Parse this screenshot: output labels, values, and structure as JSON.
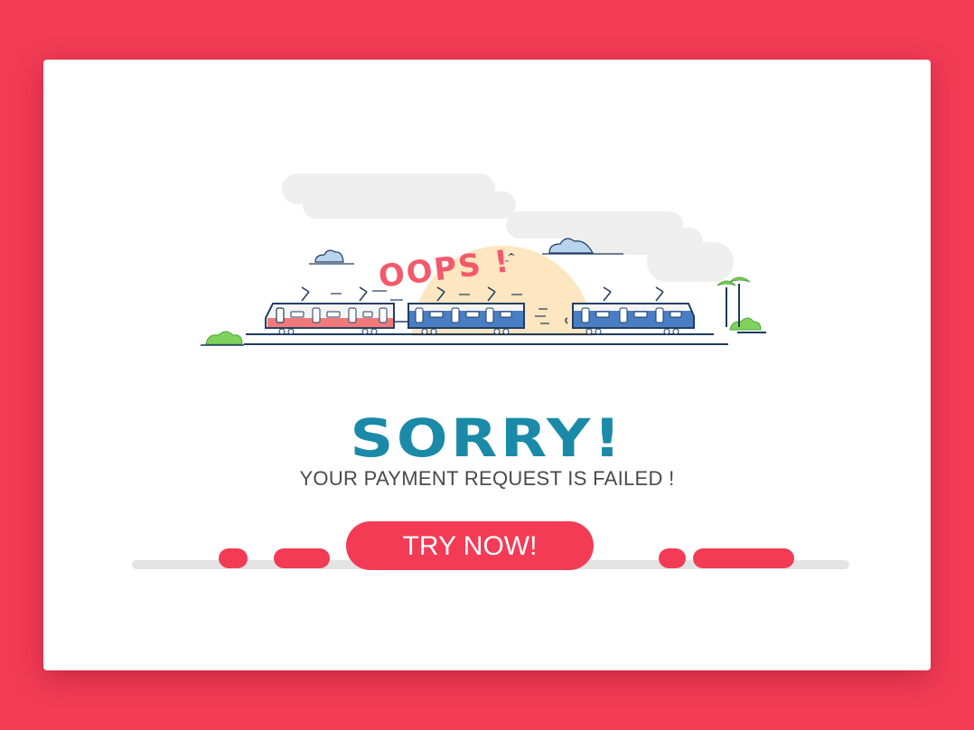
{
  "illustration": {
    "exclaim_text": "OOPS !"
  },
  "message": {
    "title": "SORRY!",
    "subtitle": "YOUR PAYMENT REQUEST IS FAILED !"
  },
  "actions": {
    "try_label": "TRY NOW!"
  },
  "colors": {
    "background": "#f33b56",
    "card": "#ffffff",
    "title": "#1a8aa8",
    "button": "#f33b56",
    "train_red": "#f07a7a",
    "train_blue": "#4a7ec4",
    "sun": "#fde6c0",
    "cloud": "#eeeeee"
  }
}
